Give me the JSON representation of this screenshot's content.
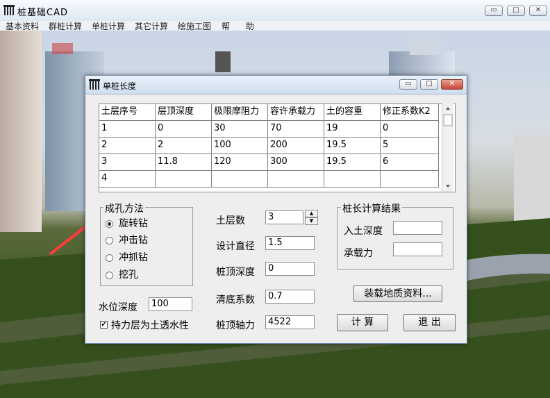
{
  "app": {
    "title": "桩基础CAD",
    "minimize_glyph": "▭",
    "maximize_glyph": "□",
    "close_glyph": "✕"
  },
  "menu": [
    "基本资料",
    "群桩计算",
    "单桩计算",
    "其它计算",
    "绘施工图",
    "帮",
    "助"
  ],
  "dialog": {
    "title": "单桩长度",
    "grid": {
      "headers": [
        "土层序号",
        "层顶深度",
        "极限摩阻力",
        "容许承载力",
        "土的容重",
        "修正系数K2"
      ],
      "rows": [
        [
          "1",
          "0",
          "30",
          "70",
          "19",
          "0"
        ],
        [
          "2",
          "2",
          "100",
          "200",
          "19.5",
          "5"
        ],
        [
          "3",
          "11.8",
          "120",
          "300",
          "19.5",
          "6"
        ],
        [
          "4",
          "",
          "",
          "",
          "",
          ""
        ]
      ]
    },
    "method": {
      "label": "成孔方法",
      "options": [
        "旋转钻",
        "冲击钻",
        "冲抓钻",
        "挖孔"
      ],
      "selected": 0
    },
    "water_depth": {
      "label": "水位深度",
      "value": "100"
    },
    "permeable": {
      "label": "持力层为土透水性",
      "checked": true,
      "check_glyph": "✔"
    },
    "params": {
      "layers": {
        "label": "土层数",
        "value": "3"
      },
      "diameter": {
        "label": "设计直径",
        "value": "1.5"
      },
      "top_depth": {
        "label": "桩顶深度",
        "value": "0"
      },
      "clean_coef": {
        "label": "清底系数",
        "value": "0.7"
      },
      "axial_force": {
        "label": "桩顶轴力",
        "value": "4522"
      }
    },
    "result": {
      "label": "桩长计算结果",
      "depth_label": "入土深度",
      "depth_value": "",
      "capacity_label": "承载力",
      "capacity_value": ""
    },
    "buttons": {
      "load": "装载地质资料...",
      "calc": "计 算",
      "exit": "退 出"
    }
  }
}
